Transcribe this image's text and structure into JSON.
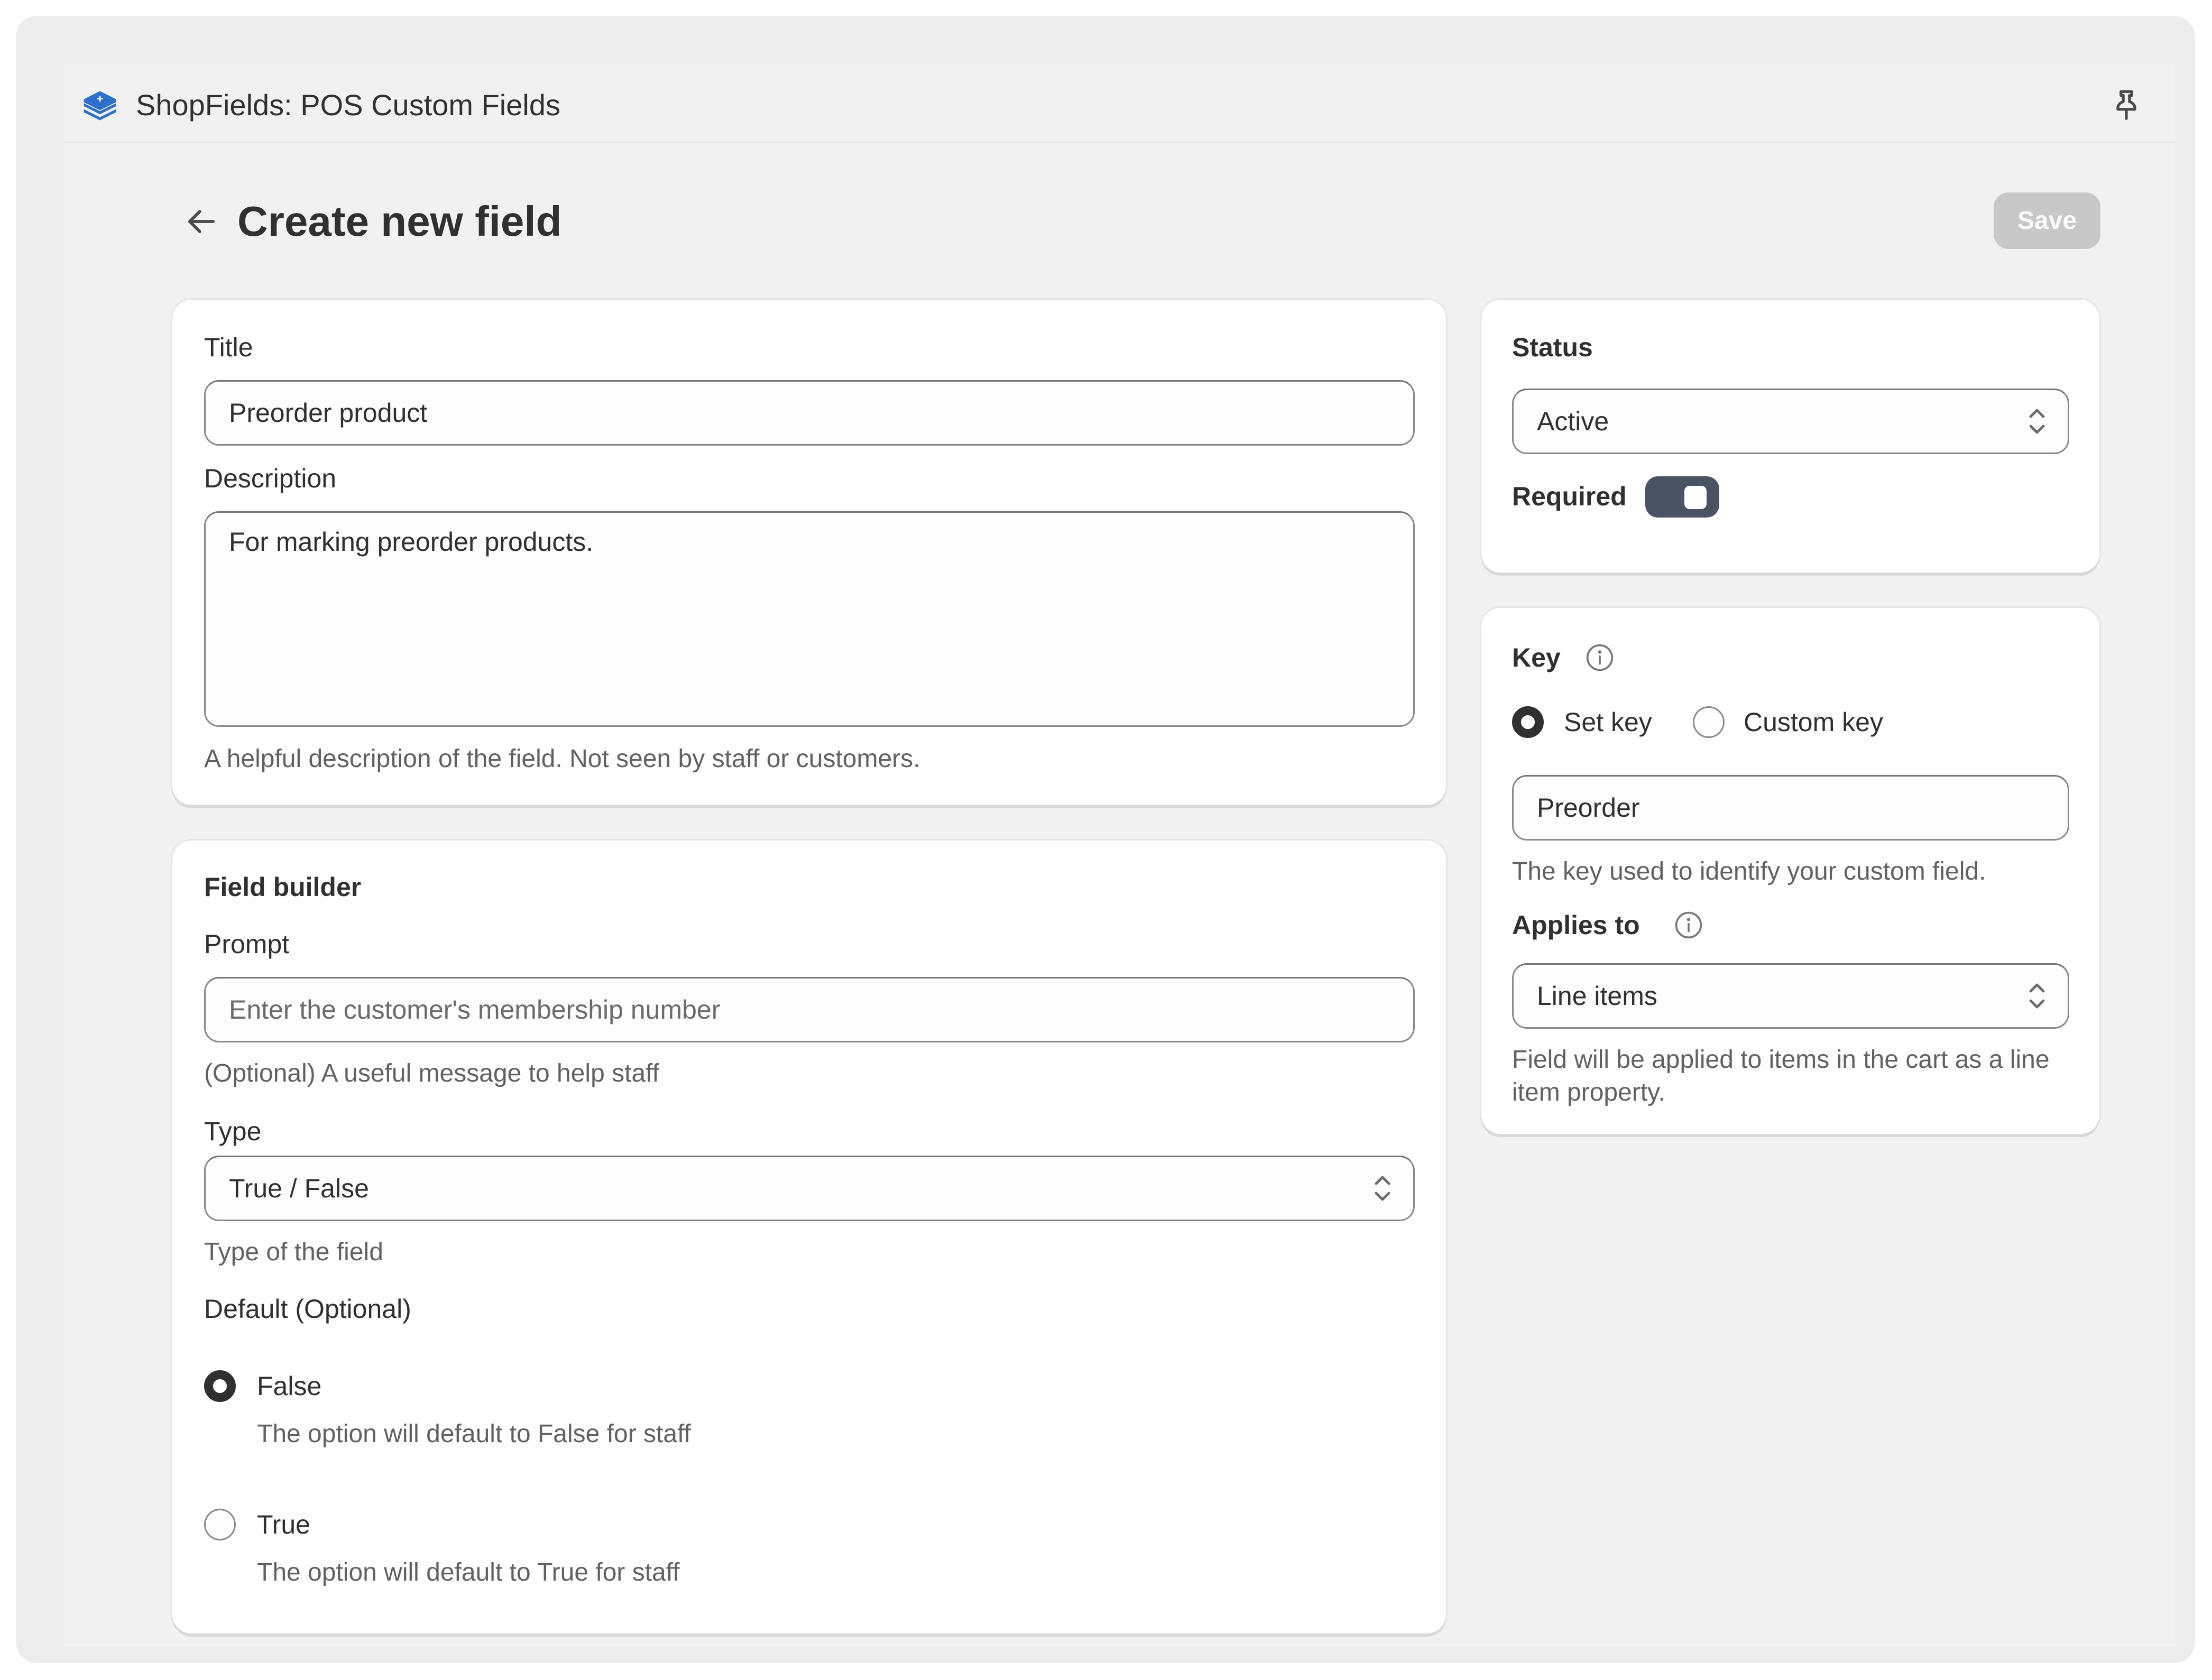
{
  "app": {
    "title": "ShopFields: POS Custom Fields",
    "logo_icon": "layers-stack-icon",
    "pin_icon": "pin-icon",
    "brand_color": "#2c6ecb"
  },
  "page": {
    "title": "Create new field",
    "back_icon": "arrow-left-icon",
    "save_label": "Save",
    "save_disabled": true
  },
  "details_card": {
    "title_label": "Title",
    "title_value": "Preorder product",
    "description_label": "Description",
    "description_value": "For marking preorder products.",
    "description_help": "A helpful description of the field. Not seen by staff or customers."
  },
  "field_builder": {
    "heading": "Field builder",
    "prompt_label": "Prompt",
    "prompt_value": "",
    "prompt_placeholder": "Enter the customer's membership number",
    "prompt_help": "(Optional) A useful message to help staff",
    "type_label": "Type",
    "type_value": "True / False",
    "type_help": "Type of the field",
    "default_label": "Default (Optional)",
    "default_options": [
      {
        "label": "False",
        "help": "The option will default to False for staff",
        "selected": true
      },
      {
        "label": "True",
        "help": "The option will default to True for staff",
        "selected": false
      }
    ]
  },
  "status_card": {
    "status_label": "Status",
    "status_value": "Active",
    "required_label": "Required",
    "required_on": true
  },
  "key_card": {
    "key_label": "Key",
    "key_options": [
      {
        "label": "Set key",
        "selected": true
      },
      {
        "label": "Custom key",
        "selected": false
      }
    ],
    "key_value": "Preorder",
    "key_help": "The key used to identify your custom field.",
    "applies_label": "Applies to",
    "applies_value": "Line items",
    "applies_help": "Field will be applied to items in the cart as a line item property."
  }
}
